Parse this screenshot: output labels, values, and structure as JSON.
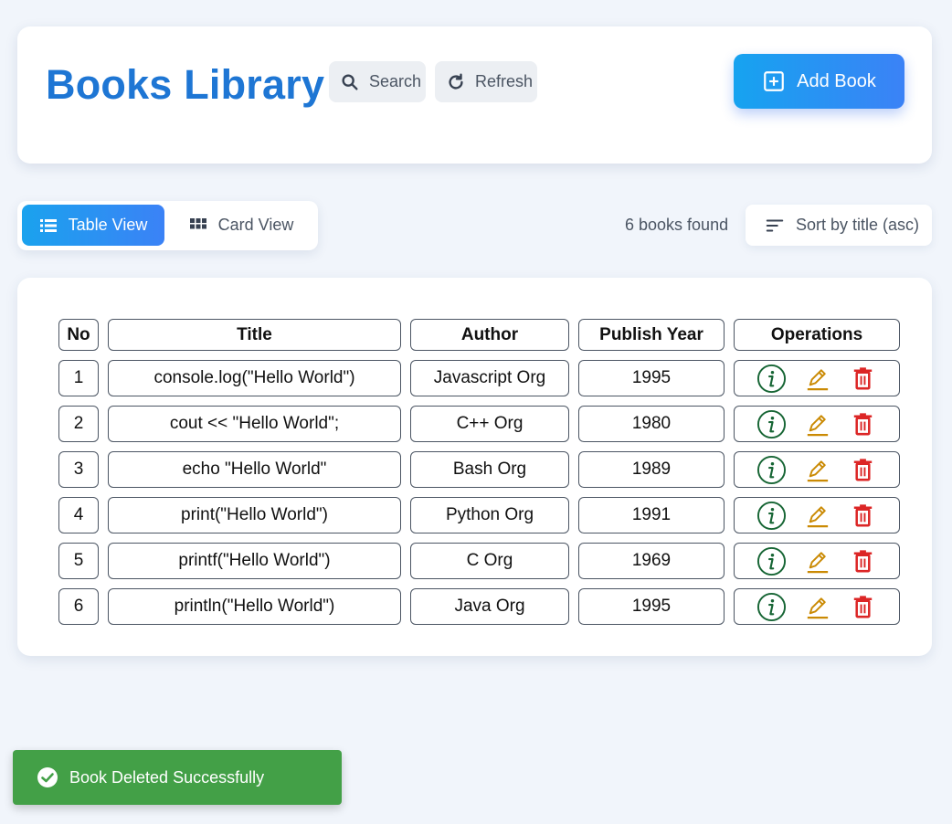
{
  "header": {
    "title": "Books Library",
    "search_label": "Search",
    "refresh_label": "Refresh",
    "add_label": "Add Book"
  },
  "view": {
    "table_label": "Table View",
    "card_label": "Card View",
    "active": "table"
  },
  "results": {
    "count_text": "6 books found",
    "sort_label": "Sort by title (asc)"
  },
  "table": {
    "headers": [
      "No",
      "Title",
      "Author",
      "Publish Year",
      "Operations"
    ],
    "rows": [
      {
        "no": "1",
        "title": "console.log(\"Hello World\")",
        "author": "Javascript Org",
        "year": "1995"
      },
      {
        "no": "2",
        "title": "cout << \"Hello World\";",
        "author": "C++ Org",
        "year": "1980"
      },
      {
        "no": "3",
        "title": "echo \"Hello World\"",
        "author": "Bash Org",
        "year": "1989"
      },
      {
        "no": "4",
        "title": "print(\"Hello World\")",
        "author": "Python Org",
        "year": "1991"
      },
      {
        "no": "5",
        "title": "printf(\"Hello World\")",
        "author": "C Org",
        "year": "1969"
      },
      {
        "no": "6",
        "title": "println(\"Hello World\")",
        "author": "Java Org",
        "year": "1995"
      }
    ]
  },
  "toast": {
    "message": "Book Deleted Successfully",
    "icon": "check-circle-icon"
  },
  "colors": {
    "title_blue": "#1e76d4",
    "info_green": "#166534",
    "edit_amber": "#ca8a04",
    "delete_red": "#dc2626",
    "toast_green": "#43a047"
  }
}
